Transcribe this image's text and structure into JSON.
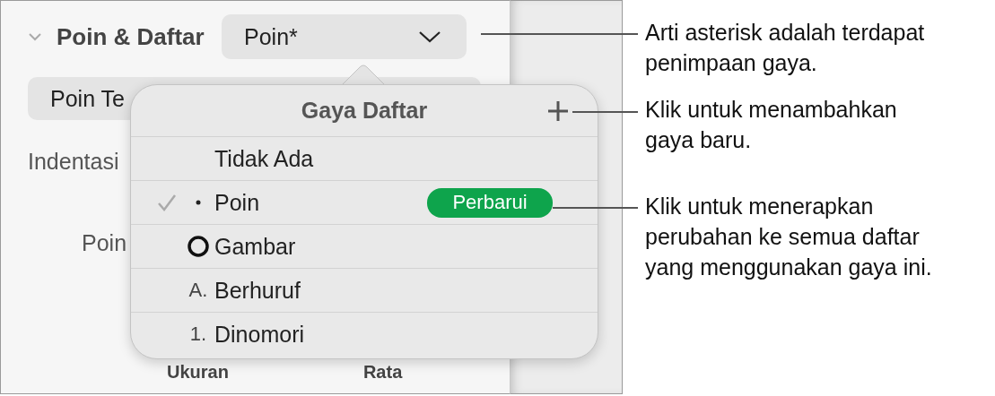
{
  "panel": {
    "section": {
      "title": "Poin & Daftar",
      "expanded": true
    },
    "style_dropdown": {
      "value": "Poin*"
    },
    "text_field": {
      "value": "Poin Te"
    },
    "indent_label": "Indentasi",
    "bullet_label": "Poin",
    "column_labels": [
      "Ukuran",
      "Rata"
    ]
  },
  "popover": {
    "title": "Gaya Daftar",
    "items": [
      {
        "kind": "none",
        "label": "Tidak Ada",
        "selected": false
      },
      {
        "kind": "bullet",
        "label": "Poin",
        "selected": true,
        "action": "Perbarui"
      },
      {
        "kind": "image",
        "label": "Gambar",
        "selected": false
      },
      {
        "kind": "letter",
        "marker": "A.",
        "label": "Berhuruf",
        "selected": false
      },
      {
        "kind": "number",
        "marker": "1.",
        "label": "Dinomori",
        "selected": false
      }
    ]
  },
  "callouts": [
    {
      "text": "Arti asterisk adalah terdapat penimpaan gaya."
    },
    {
      "text": "Klik untuk menambahkan gaya baru."
    },
    {
      "text": "Klik untuk menerapkan perubahan ke semua daftar yang menggunakan gaya ini."
    }
  ]
}
